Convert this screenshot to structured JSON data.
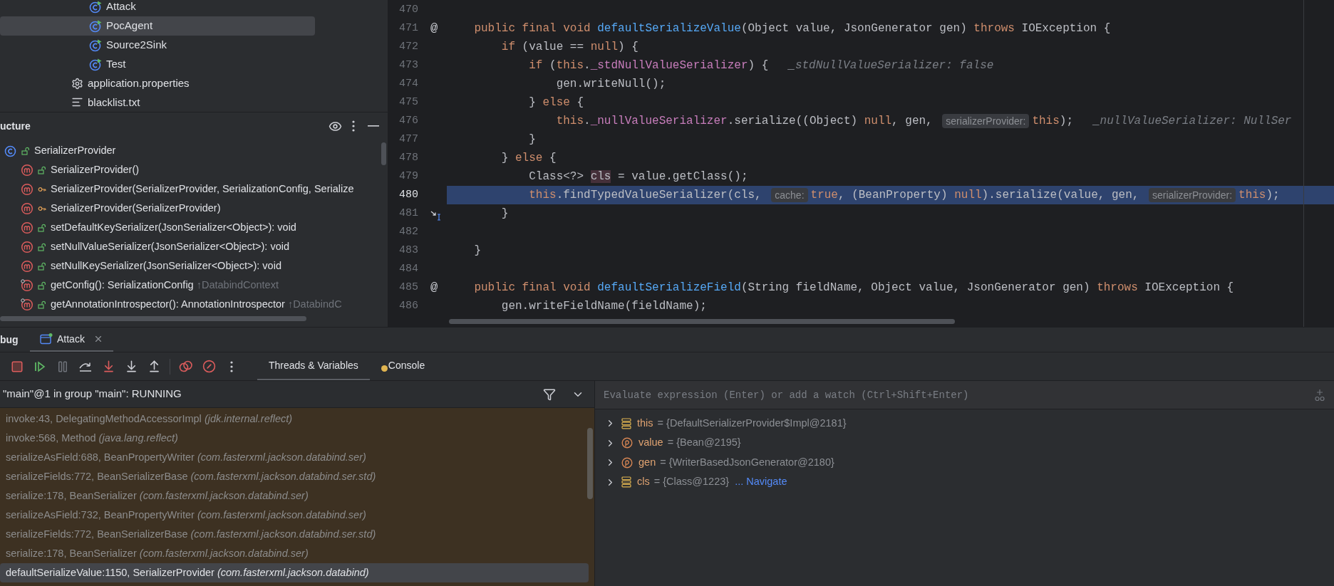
{
  "project_tree": [
    {
      "kind": "group",
      "children": [
        {
          "label": "Attack",
          "kind": "runnable_class",
          "selected": false
        },
        {
          "label": "PocAgent",
          "kind": "runnable_class",
          "selected": true
        },
        {
          "label": "Source2Sink",
          "kind": "runnable_class",
          "selected": false
        },
        {
          "label": "Test",
          "kind": "runnable_class",
          "selected": false
        }
      ]
    },
    {
      "label": "application.properties",
      "kind": "properties_file",
      "selected": false
    },
    {
      "label": "blacklist.txt",
      "kind": "text_file",
      "selected": false
    }
  ],
  "structure": {
    "title": "ucture",
    "tree": [
      {
        "label": "SerializerProvider",
        "kind": "class",
        "protected": false,
        "children": [
          {
            "label": "SerializerProvider()",
            "kind": "method",
            "protected": false
          },
          {
            "label": "SerializerProvider(SerializerProvider, SerializationConfig, Serialize",
            "kind": "method",
            "protected": true
          },
          {
            "label": "SerializerProvider(SerializerProvider)",
            "kind": "method",
            "protected": true
          },
          {
            "label": "setDefaultKeySerializer(JsonSerializer<Object>): void",
            "kind": "method",
            "protected": false
          },
          {
            "label": "setNullValueSerializer(JsonSerializer<Object>): void",
            "kind": "method",
            "protected": false
          },
          {
            "label": "setNullKeySerializer(JsonSerializer<Object>): void",
            "kind": "method",
            "protected": false
          },
          {
            "label": "getConfig(): SerializationConfig",
            "kind": "method",
            "protected": false,
            "inherited_from": "↑DatabindContext"
          },
          {
            "label": "getAnnotationIntrospector(): AnnotationIntrospector",
            "kind": "method",
            "protected": false,
            "inherited_from": "↑DatabindC"
          }
        ]
      }
    ]
  },
  "editor": {
    "lines": [
      {
        "number": "470",
        "cursor_marker": false
      },
      {
        "number": "471",
        "gutter": "@",
        "cursor_marker": false,
        "tokens": [
          {
            "t": "    public final void ",
            "kind": "keyword"
          },
          {
            "t": "defaultSerializeValue",
            "kind": "function"
          },
          {
            "t": "(Object value, JsonGenerator gen) ",
            "kind": "plain"
          },
          {
            "t": "throws",
            "kind": "keyword"
          },
          {
            "t": " IOException {",
            "kind": "plain"
          }
        ]
      },
      {
        "number": "472",
        "cursor_marker": false,
        "tokens": [
          {
            "t": "        if",
            "kind": "keyword"
          },
          {
            "t": " (value == ",
            "kind": "plain"
          },
          {
            "t": "null",
            "kind": "keyword"
          },
          {
            "t": ") {",
            "kind": "plain"
          }
        ]
      },
      {
        "number": "473",
        "cursor_marker": false,
        "tokens": [
          {
            "t": "            if",
            "kind": "keyword"
          },
          {
            "t": " (",
            "kind": "plain"
          },
          {
            "t": "this",
            "kind": "keyword"
          },
          {
            "t": ".",
            "kind": "plain"
          },
          {
            "t": "_stdNullValueSerializer",
            "kind": "field"
          },
          {
            "t": ") {",
            "kind": "plain"
          },
          {
            "t": "_stdNullValueSerializer: false",
            "kind": "inline"
          }
        ]
      },
      {
        "number": "474",
        "cursor_marker": false,
        "tokens": [
          {
            "t": "                gen.writeNull();",
            "kind": "plain"
          }
        ]
      },
      {
        "number": "475",
        "cursor_marker": false,
        "tokens": [
          {
            "t": "            } ",
            "kind": "plain"
          },
          {
            "t": "else",
            "kind": "keyword"
          },
          {
            "t": " {",
            "kind": "plain"
          }
        ]
      },
      {
        "number": "476",
        "cursor_marker": false,
        "tokens": [
          {
            "t": "                this",
            "kind": "keyword"
          },
          {
            "t": ".",
            "kind": "plain"
          },
          {
            "t": "_nullValueSerializer",
            "kind": "field"
          },
          {
            "t": ".serialize((Object) ",
            "kind": "plain"
          },
          {
            "t": "null",
            "kind": "keyword"
          },
          {
            "t": ", gen, ",
            "kind": "plain"
          },
          {
            "t": "serializerProvider:",
            "kind": "hint"
          },
          {
            "t": "this",
            "kind": "keyword"
          },
          {
            "t": ");",
            "kind": "plain"
          },
          {
            "t": "_nullValueSerializer: NullSer",
            "kind": "inline"
          }
        ]
      },
      {
        "number": "477",
        "cursor_marker": false,
        "tokens": [
          {
            "t": "            }",
            "kind": "plain"
          }
        ]
      },
      {
        "number": "478",
        "cursor_marker": false,
        "tokens": [
          {
            "t": "        } ",
            "kind": "plain"
          },
          {
            "t": "else",
            "kind": "keyword"
          },
          {
            "t": " {",
            "kind": "plain"
          }
        ]
      },
      {
        "number": "479",
        "cursor_marker": false,
        "tokens": [
          {
            "t": "            Class<?> ",
            "kind": "plain"
          },
          {
            "t": "cls",
            "kind": "highlighted"
          },
          {
            "t": " = value.getClass();",
            "kind": "plain"
          }
        ]
      },
      {
        "number": "480",
        "selected": true,
        "cursor_marker": false,
        "tokens": [
          {
            "t": "            this",
            "kind": "keyword"
          },
          {
            "t": ".findTypedValueSerializer(cls, ",
            "kind": "plain"
          },
          {
            "t": "cache:",
            "kind": "hint"
          },
          {
            "t": "true",
            "kind": "keyword"
          },
          {
            "t": ", (BeanProperty) ",
            "kind": "plain"
          },
          {
            "t": "null",
            "kind": "keyword"
          },
          {
            "t": ").serialize(value, gen, ",
            "kind": "plain"
          },
          {
            "t": "serializerProvider:",
            "kind": "hint"
          },
          {
            "t": "this",
            "kind": "keyword"
          },
          {
            "t": ");",
            "kind": "plain"
          }
        ]
      },
      {
        "number": "481",
        "cursor_marker": true,
        "tokens": [
          {
            "t": "        }",
            "kind": "plain"
          }
        ]
      },
      {
        "number": "482",
        "cursor_marker": false
      },
      {
        "number": "483",
        "cursor_marker": false,
        "tokens": [
          {
            "t": "    }",
            "kind": "plain"
          }
        ]
      },
      {
        "number": "484",
        "cursor_marker": false
      },
      {
        "number": "485",
        "gutter": "@",
        "cursor_marker": false,
        "tokens": [
          {
            "t": "    public final void ",
            "kind": "keyword"
          },
          {
            "t": "defaultSerializeField",
            "kind": "function"
          },
          {
            "t": "(String fieldName, Object value, JsonGenerator gen) ",
            "kind": "plain"
          },
          {
            "t": "throws",
            "kind": "keyword"
          },
          {
            "t": " IOException {",
            "kind": "plain"
          }
        ]
      },
      {
        "number": "486",
        "cursor_marker": false,
        "tokens": [
          {
            "t": "        gen.writeFieldName(fieldName);",
            "kind": "plain"
          }
        ]
      }
    ]
  },
  "debug": {
    "title": "bug",
    "sessions": [
      {
        "label": "Attack",
        "selected": true
      }
    ],
    "toolbar": [
      {
        "kind": "stop",
        "disabled": false
      },
      {
        "kind": "resume",
        "disabled": false
      },
      {
        "kind": "pause",
        "disabled": true
      },
      {
        "kind": "step_over",
        "disabled": false
      },
      {
        "kind": "force_step_into",
        "disabled": false
      },
      {
        "kind": "step_into",
        "disabled": false
      },
      {
        "kind": "step_out",
        "disabled": false
      },
      {
        "kind": "separator"
      },
      {
        "kind": "breakpoints",
        "disabled": false
      },
      {
        "kind": "mute",
        "disabled": false
      },
      {
        "kind": "more",
        "disabled": false
      }
    ],
    "tabs": [
      {
        "label": "Threads & Variables",
        "selected": true
      },
      {
        "label": "Console",
        "selected": false
      }
    ],
    "thread": "\"main\"@1 in group \"main\": RUNNING",
    "frames": [
      {
        "label": "invoke:43, DelegatingMethodAccessorImpl *(jdk.internal.reflect)*",
        "selected": false
      },
      {
        "label": "invoke:568, Method *(java.lang.reflect)*",
        "selected": false
      },
      {
        "label": "serializeAsField:688, BeanPropertyWriter *(com.fasterxml.jackson.databind.ser)*",
        "selected": false
      },
      {
        "label": "serializeFields:772, BeanSerializerBase *(com.fasterxml.jackson.databind.ser.std)*",
        "selected": false
      },
      {
        "label": "serialize:178, BeanSerializer *(com.fasterxml.jackson.databind.ser)*",
        "selected": false
      },
      {
        "label": "serializeAsField:732, BeanPropertyWriter *(com.fasterxml.jackson.databind.ser)*",
        "selected": false
      },
      {
        "label": "serializeFields:772, BeanSerializerBase *(com.fasterxml.jackson.databind.ser.std)*",
        "selected": false
      },
      {
        "label": "serialize:178, BeanSerializer *(com.fasterxml.jackson.databind.ser)*",
        "selected": false
      },
      {
        "label": "defaultSerializeValue:1150, SerializerProvider *(com.fasterxml.jackson.databind)*",
        "selected": true
      }
    ],
    "evaluate": {
      "placeholder": "Evaluate expression (Enter) or add a watch (Ctrl+Shift+Enter)"
    },
    "variables": [
      {
        "kind": "field",
        "name": "this",
        "value": "= {DefaultSerializerProvider$Impl@2181}"
      },
      {
        "kind": "param",
        "name": "value",
        "value": "= {Bean@2195}"
      },
      {
        "kind": "param",
        "name": "gen",
        "value": "= {WriterBasedJsonGenerator@2180}"
      },
      {
        "kind": "field",
        "name": "cls",
        "value": "= {Class@1223}",
        "link": "... Navigate"
      }
    ]
  }
}
